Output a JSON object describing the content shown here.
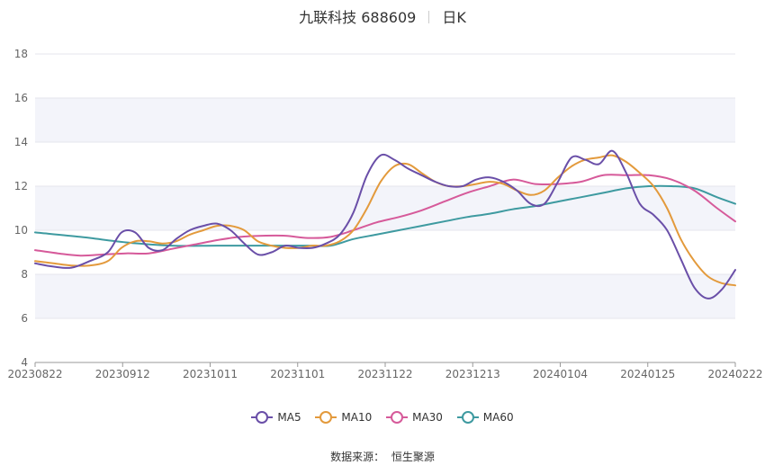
{
  "header": {
    "title": "九联科技 688609",
    "period": "日K"
  },
  "footer": {
    "source_label": "数据来源：",
    "source_value": "恒生聚源"
  },
  "colors": {
    "up": "#f07070",
    "down": "#88ee44",
    "MA5": "#6a4fa8",
    "MA10": "#e39a3c",
    "MA30": "#d65a9a",
    "MA60": "#3e9aa0",
    "grid": "#e6e6ec",
    "band": "#f3f4fa"
  },
  "chart_data": {
    "type": "candlestick",
    "title": "九联科技 688609",
    "subtitle": "日K",
    "ylim": [
      4,
      18
    ],
    "y_ticks": [
      4,
      6,
      8,
      10,
      12,
      14,
      16,
      18
    ],
    "x_ticks": [
      "20230822",
      "20230912",
      "20231011",
      "20231101",
      "20231122",
      "20231213",
      "20240104",
      "20240125",
      "20240222"
    ],
    "grid": true,
    "legend_position": "bottom",
    "candles": [],
    "series": [
      {
        "name": "MA5",
        "points": [
          [
            0,
            8.5
          ],
          [
            4,
            8.35
          ],
          [
            8,
            8.3
          ],
          [
            12,
            8.6
          ],
          [
            16,
            9.0
          ],
          [
            19,
            9.9
          ],
          [
            22,
            9.9
          ],
          [
            25,
            9.2
          ],
          [
            28,
            9.1
          ],
          [
            31,
            9.6
          ],
          [
            34,
            10.0
          ],
          [
            37,
            10.2
          ],
          [
            40,
            10.3
          ],
          [
            43,
            10.0
          ],
          [
            46,
            9.4
          ],
          [
            49,
            8.9
          ],
          [
            52,
            9.0
          ],
          [
            55,
            9.3
          ],
          [
            58,
            9.2
          ],
          [
            61,
            9.2
          ],
          [
            64,
            9.4
          ],
          [
            67,
            9.8
          ],
          [
            70,
            10.8
          ],
          [
            73,
            12.5
          ],
          [
            76,
            13.4
          ],
          [
            79,
            13.2
          ],
          [
            82,
            12.8
          ],
          [
            85,
            12.5
          ],
          [
            88,
            12.2
          ],
          [
            91,
            12.0
          ],
          [
            94,
            12.0
          ],
          [
            97,
            12.3
          ],
          [
            100,
            12.4
          ],
          [
            103,
            12.2
          ],
          [
            106,
            11.8
          ],
          [
            109,
            11.2
          ],
          [
            112,
            11.2
          ],
          [
            115,
            12.2
          ],
          [
            118,
            13.3
          ],
          [
            121,
            13.2
          ],
          [
            124,
            13.0
          ],
          [
            127,
            13.6
          ],
          [
            130,
            12.6
          ],
          [
            133,
            11.2
          ],
          [
            136,
            10.7
          ],
          [
            139,
            10.0
          ],
          [
            142,
            8.7
          ],
          [
            145,
            7.4
          ],
          [
            148,
            6.9
          ],
          [
            151,
            7.3
          ],
          [
            154,
            8.2
          ]
        ]
      },
      {
        "name": "MA10",
        "points": [
          [
            0,
            8.6
          ],
          [
            4,
            8.5
          ],
          [
            8,
            8.4
          ],
          [
            12,
            8.4
          ],
          [
            16,
            8.6
          ],
          [
            19,
            9.2
          ],
          [
            22,
            9.5
          ],
          [
            25,
            9.5
          ],
          [
            28,
            9.4
          ],
          [
            31,
            9.5
          ],
          [
            34,
            9.8
          ],
          [
            37,
            10.0
          ],
          [
            40,
            10.2
          ],
          [
            43,
            10.2
          ],
          [
            46,
            10.0
          ],
          [
            49,
            9.5
          ],
          [
            52,
            9.3
          ],
          [
            55,
            9.2
          ],
          [
            58,
            9.2
          ],
          [
            61,
            9.3
          ],
          [
            64,
            9.3
          ],
          [
            67,
            9.5
          ],
          [
            70,
            10.0
          ],
          [
            73,
            11.0
          ],
          [
            76,
            12.2
          ],
          [
            79,
            12.9
          ],
          [
            82,
            13.0
          ],
          [
            85,
            12.6
          ],
          [
            88,
            12.2
          ],
          [
            91,
            12.0
          ],
          [
            94,
            12.0
          ],
          [
            97,
            12.1
          ],
          [
            100,
            12.2
          ],
          [
            103,
            12.1
          ],
          [
            106,
            11.8
          ],
          [
            109,
            11.6
          ],
          [
            112,
            11.8
          ],
          [
            115,
            12.4
          ],
          [
            118,
            12.9
          ],
          [
            121,
            13.2
          ],
          [
            124,
            13.3
          ],
          [
            127,
            13.4
          ],
          [
            130,
            13.1
          ],
          [
            133,
            12.6
          ],
          [
            136,
            12.0
          ],
          [
            139,
            11.0
          ],
          [
            142,
            9.6
          ],
          [
            145,
            8.6
          ],
          [
            148,
            7.9
          ],
          [
            151,
            7.6
          ],
          [
            154,
            7.5
          ]
        ]
      },
      {
        "name": "MA30",
        "points": [
          [
            0,
            9.1
          ],
          [
            5,
            8.95
          ],
          [
            10,
            8.85
          ],
          [
            15,
            8.9
          ],
          [
            20,
            8.95
          ],
          [
            25,
            8.95
          ],
          [
            30,
            9.15
          ],
          [
            35,
            9.35
          ],
          [
            40,
            9.55
          ],
          [
            45,
            9.7
          ],
          [
            50,
            9.75
          ],
          [
            55,
            9.75
          ],
          [
            60,
            9.65
          ],
          [
            65,
            9.7
          ],
          [
            70,
            10.0
          ],
          [
            75,
            10.35
          ],
          [
            80,
            10.6
          ],
          [
            85,
            10.9
          ],
          [
            90,
            11.3
          ],
          [
            95,
            11.7
          ],
          [
            100,
            12.0
          ],
          [
            105,
            12.3
          ],
          [
            110,
            12.1
          ],
          [
            115,
            12.1
          ],
          [
            120,
            12.2
          ],
          [
            125,
            12.5
          ],
          [
            130,
            12.5
          ],
          [
            135,
            12.5
          ],
          [
            140,
            12.3
          ],
          [
            145,
            11.8
          ],
          [
            150,
            11.0
          ],
          [
            154,
            10.4
          ]
        ]
      },
      {
        "name": "MA60",
        "points": [
          [
            0,
            9.9
          ],
          [
            10,
            9.7
          ],
          [
            20,
            9.45
          ],
          [
            30,
            9.3
          ],
          [
            40,
            9.3
          ],
          [
            50,
            9.3
          ],
          [
            60,
            9.3
          ],
          [
            65,
            9.3
          ],
          [
            70,
            9.6
          ],
          [
            75,
            9.8
          ],
          [
            80,
            10.0
          ],
          [
            85,
            10.2
          ],
          [
            90,
            10.4
          ],
          [
            95,
            10.6
          ],
          [
            100,
            10.75
          ],
          [
            105,
            10.95
          ],
          [
            110,
            11.1
          ],
          [
            115,
            11.3
          ],
          [
            120,
            11.5
          ],
          [
            125,
            11.7
          ],
          [
            130,
            11.9
          ],
          [
            135,
            12.0
          ],
          [
            140,
            12.0
          ],
          [
            145,
            11.9
          ],
          [
            150,
            11.5
          ],
          [
            154,
            11.2
          ]
        ]
      }
    ]
  }
}
